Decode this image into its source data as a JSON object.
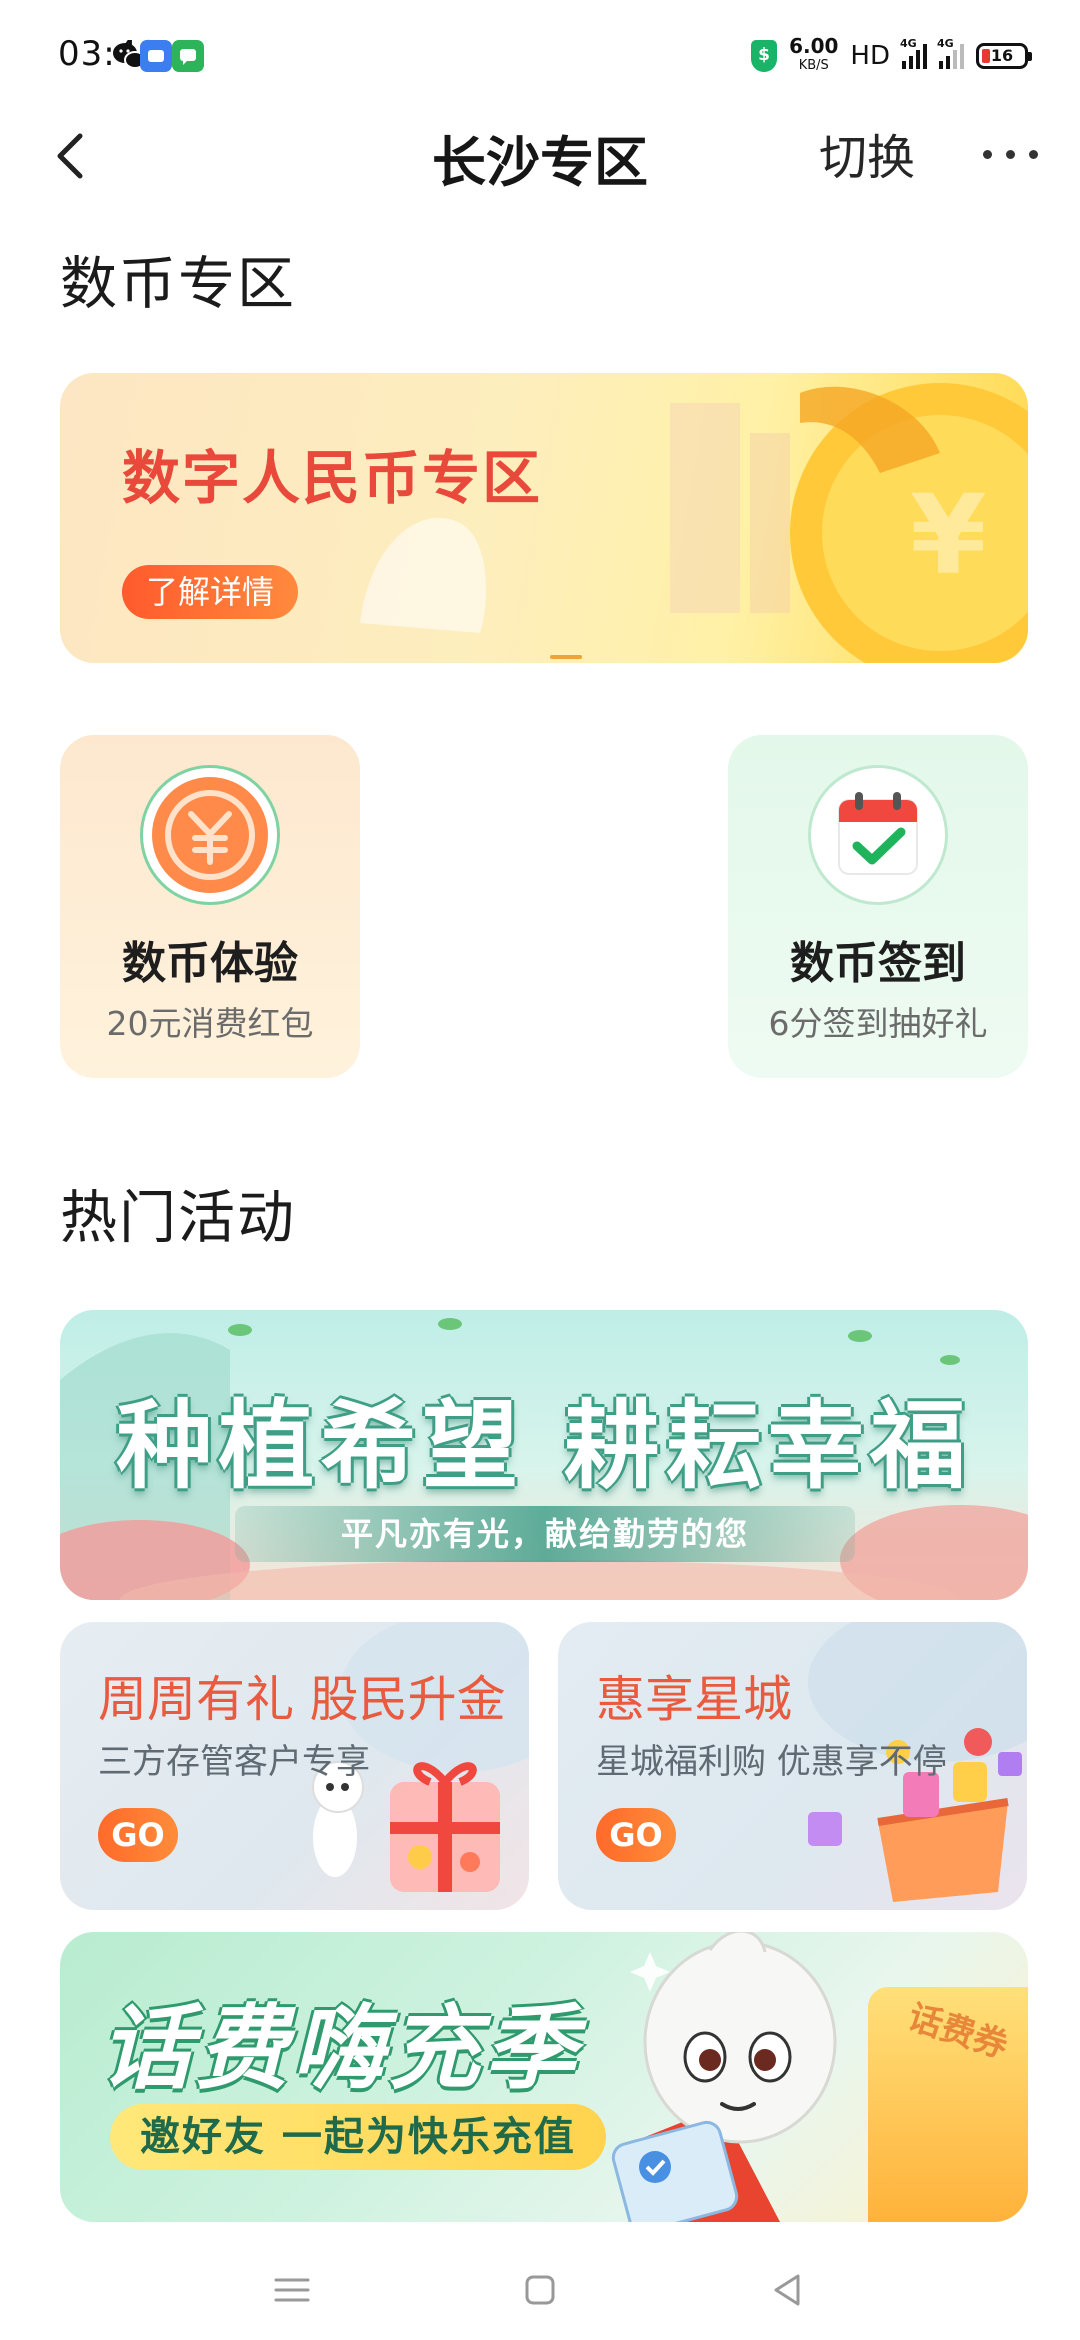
{
  "status_bar": {
    "time": "03:49",
    "net_speed_value": "6.00",
    "net_speed_unit": "KB/S",
    "hd": "HD",
    "signal1": "4G",
    "signal2": "4G",
    "battery": "16",
    "shield_glyph": "$"
  },
  "header": {
    "title": "长沙专区",
    "switch_label": "切换"
  },
  "sections": {
    "digital_currency": "数币专区",
    "hot_activities": "热门活动"
  },
  "banner_digital_rmb": {
    "title": "数字人民币专区",
    "button": "了解详情"
  },
  "services": [
    {
      "name": "数币体验",
      "sub": "20元消费红包",
      "icon": "yuan-coin-icon"
    },
    {
      "name": "数币签到",
      "sub": "6分签到抽好礼",
      "icon": "calendar-check-icon"
    }
  ],
  "banner_plant_hope": {
    "title": "种植希望 耕耘幸福",
    "subtitle": "平凡亦有光，献给勤劳的您"
  },
  "promo_cards": [
    {
      "title": "周周有礼 股民升金",
      "sub": "三方存管客户专享",
      "go": "GO"
    },
    {
      "title": "惠享星城",
      "sub": "星城福利购 优惠享不停",
      "go": "GO"
    }
  ],
  "banner_phone_recharge": {
    "title": "话费嗨充季",
    "pill": "邀好友 一起为快乐充值",
    "coupon": "话费券"
  },
  "colors": {
    "accent_red": "#e95a3e",
    "go_orange": "#ff6a2a",
    "green": "#2f9a6d"
  }
}
